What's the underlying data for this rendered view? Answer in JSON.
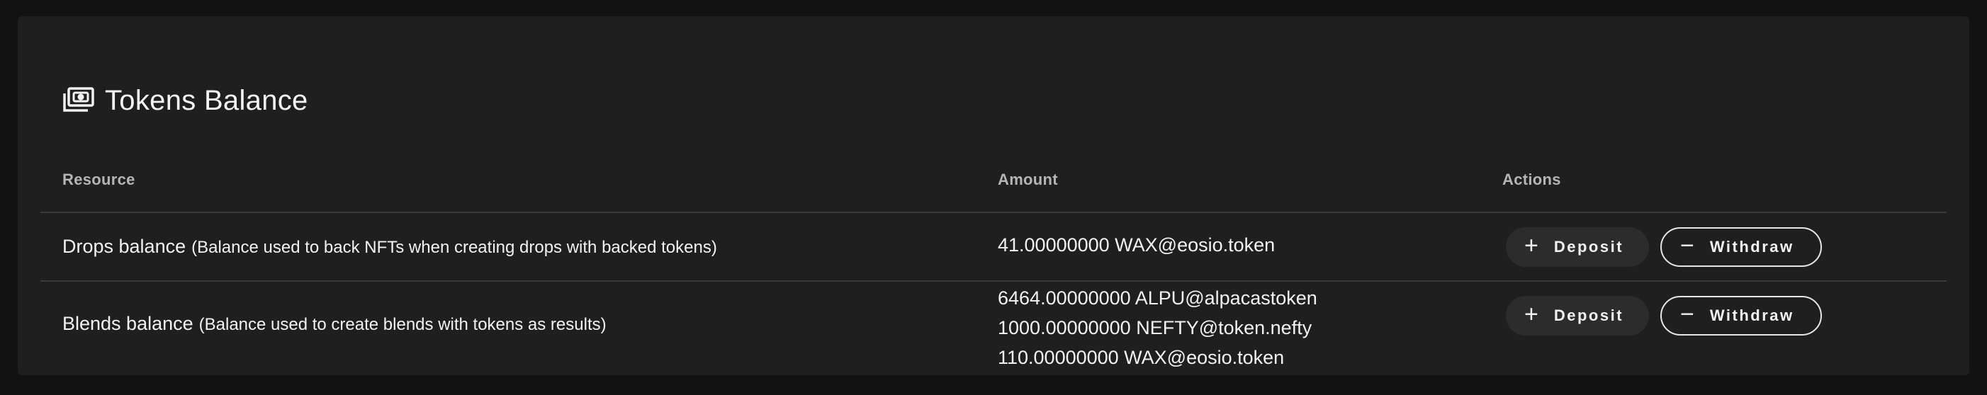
{
  "card": {
    "title": "Tokens Balance",
    "icon": "money-icon"
  },
  "table": {
    "headers": {
      "resource": "Resource",
      "amount": "Amount",
      "actions": "Actions"
    },
    "rows": [
      {
        "name": "Drops balance",
        "description": "(Balance used to back NFTs when creating drops with backed tokens)",
        "amounts": [
          "41.00000000 WAX@eosio.token"
        ],
        "deposit_label": "Deposit",
        "withdraw_label": "Withdraw"
      },
      {
        "name": "Blends balance",
        "description": "(Balance used to create blends with tokens as results)",
        "amounts": [
          "6464.00000000 ALPU@alpacastoken",
          "1000.00000000 NEFTY@token.nefty",
          "110.00000000 WAX@eosio.token"
        ],
        "deposit_label": "Deposit",
        "withdraw_label": "Withdraw"
      }
    ]
  },
  "icons": {
    "plus": "plus-icon",
    "minus": "minus-icon"
  }
}
